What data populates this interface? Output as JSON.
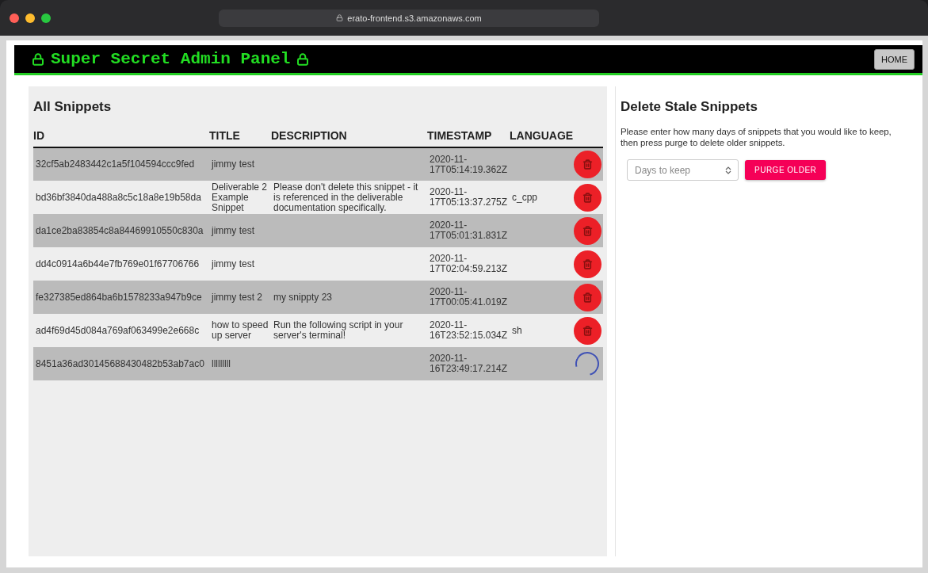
{
  "browser": {
    "address": "erato-frontend.s3.amazonaws.com"
  },
  "header": {
    "title": "Super Secret Admin Panel",
    "home_button": "HOME"
  },
  "snippets": {
    "title": "All Snippets",
    "columns": [
      "ID",
      "TITLE",
      "DESCRIPTION",
      "TIMESTAMP",
      "LANGUAGE"
    ],
    "rows": [
      {
        "id": "32cf5ab2483442c1a5f104594ccc9fed",
        "title": "jimmy test",
        "description": "",
        "timestamp": "2020-11-17T05:14:19.362Z",
        "language": "",
        "deleting": false
      },
      {
        "id": "bd36bf3840da488a8c5c18a8e19b58da",
        "title": "Deliverable 2 Example Snippet",
        "description": "Please don't delete this snippet - it is referenced in the deliverable documentation specifically.",
        "timestamp": "2020-11-17T05:13:37.275Z",
        "language": "c_cpp",
        "deleting": false
      },
      {
        "id": "da1ce2ba83854c8a84469910550c830a",
        "title": "jimmy test",
        "description": "",
        "timestamp": "2020-11-17T05:01:31.831Z",
        "language": "",
        "deleting": false
      },
      {
        "id": "dd4c0914a6b44e7fb769e01f67706766",
        "title": "jimmy test",
        "description": "",
        "timestamp": "2020-11-17T02:04:59.213Z",
        "language": "",
        "deleting": false
      },
      {
        "id": "fe327385ed864ba6b1578233a947b9ce",
        "title": "jimmy test 2",
        "description": "my snippty 23",
        "timestamp": "2020-11-17T00:05:41.019Z",
        "language": "",
        "deleting": false
      },
      {
        "id": "ad4f69d45d084a769af063499e2e668c",
        "title": "how to speed up server",
        "description": "Run the following script in your server's terminal!",
        "timestamp": "2020-11-16T23:52:15.034Z",
        "language": "sh",
        "deleting": false
      },
      {
        "id": "8451a36ad30145688430482b53ab7ac0",
        "title": "lllllllll",
        "description": "",
        "timestamp": "2020-11-16T23:49:17.214Z",
        "language": "",
        "deleting": true
      }
    ]
  },
  "purge": {
    "title": "Delete Stale Snippets",
    "text": "Please enter how many days of snippets that you would like to keep, then press purge to delete older snippets.",
    "placeholder": "Days to keep",
    "button": "PURGE OLDER"
  }
}
